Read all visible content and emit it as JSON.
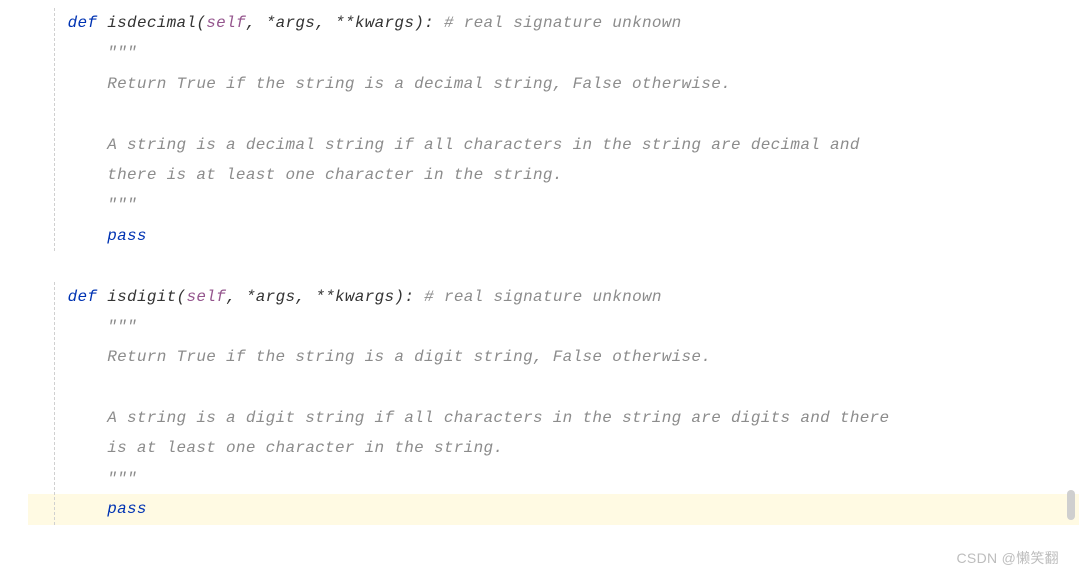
{
  "functions": [
    {
      "def": "def",
      "name": "isdecimal",
      "sig_open": "(",
      "self": "self",
      "comma1": ", ",
      "args": "*args",
      "comma2": ", ",
      "kwargs": "**kwargs",
      "sig_close": "):",
      "trailing_comment": " # real signature unknown",
      "doc_open": "        \"\"\"",
      "doc_line1": "        Return True if the string is a decimal string, False otherwise.",
      "doc_blank": "",
      "doc_line2": "        A string is a decimal string if all characters in the string are decimal and",
      "doc_line3": "        there is at least one character in the string.",
      "doc_close": "        \"\"\"",
      "pass_indent": "        ",
      "pass_kw": "pass"
    },
    {
      "def": "def",
      "name": "isdigit",
      "sig_open": "(",
      "self": "self",
      "comma1": ", ",
      "args": "*args",
      "comma2": ", ",
      "kwargs": "**kwargs",
      "sig_close": "):",
      "trailing_comment": " # real signature unknown",
      "doc_open": "        \"\"\"",
      "doc_line1": "        Return True if the string is a digit string, False otherwise.",
      "doc_blank": "",
      "doc_line2": "        A string is a digit string if all characters in the string are digits and there",
      "doc_line3": "        is at least one character in the string.",
      "doc_close": "        \"\"\"",
      "pass_indent": "        ",
      "pass_kw": "pass"
    }
  ],
  "indent4": "    ",
  "watermark": "CSDN @懒笑翻"
}
